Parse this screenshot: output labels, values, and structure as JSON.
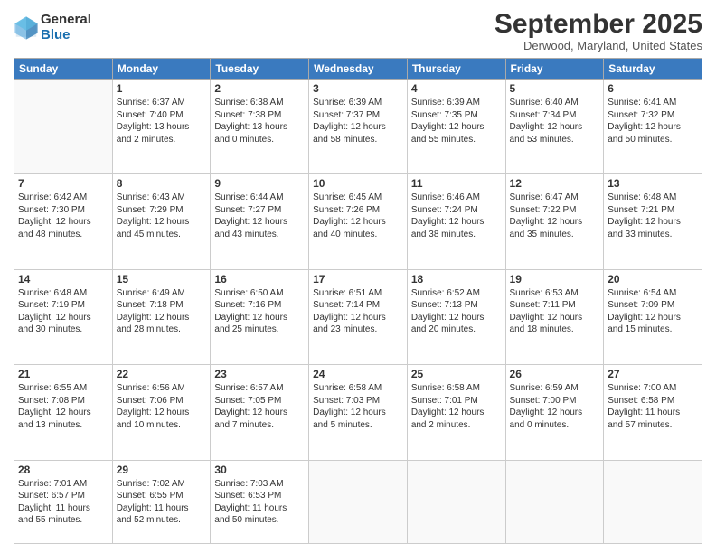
{
  "logo": {
    "general": "General",
    "blue": "Blue"
  },
  "header": {
    "month": "September 2025",
    "location": "Derwood, Maryland, United States"
  },
  "days_of_week": [
    "Sunday",
    "Monday",
    "Tuesday",
    "Wednesday",
    "Thursday",
    "Friday",
    "Saturday"
  ],
  "weeks": [
    [
      {
        "day": "",
        "lines": []
      },
      {
        "day": "1",
        "lines": [
          "Sunrise: 6:37 AM",
          "Sunset: 7:40 PM",
          "Daylight: 13 hours",
          "and 2 minutes."
        ]
      },
      {
        "day": "2",
        "lines": [
          "Sunrise: 6:38 AM",
          "Sunset: 7:38 PM",
          "Daylight: 13 hours",
          "and 0 minutes."
        ]
      },
      {
        "day": "3",
        "lines": [
          "Sunrise: 6:39 AM",
          "Sunset: 7:37 PM",
          "Daylight: 12 hours",
          "and 58 minutes."
        ]
      },
      {
        "day": "4",
        "lines": [
          "Sunrise: 6:39 AM",
          "Sunset: 7:35 PM",
          "Daylight: 12 hours",
          "and 55 minutes."
        ]
      },
      {
        "day": "5",
        "lines": [
          "Sunrise: 6:40 AM",
          "Sunset: 7:34 PM",
          "Daylight: 12 hours",
          "and 53 minutes."
        ]
      },
      {
        "day": "6",
        "lines": [
          "Sunrise: 6:41 AM",
          "Sunset: 7:32 PM",
          "Daylight: 12 hours",
          "and 50 minutes."
        ]
      }
    ],
    [
      {
        "day": "7",
        "lines": [
          "Sunrise: 6:42 AM",
          "Sunset: 7:30 PM",
          "Daylight: 12 hours",
          "and 48 minutes."
        ]
      },
      {
        "day": "8",
        "lines": [
          "Sunrise: 6:43 AM",
          "Sunset: 7:29 PM",
          "Daylight: 12 hours",
          "and 45 minutes."
        ]
      },
      {
        "day": "9",
        "lines": [
          "Sunrise: 6:44 AM",
          "Sunset: 7:27 PM",
          "Daylight: 12 hours",
          "and 43 minutes."
        ]
      },
      {
        "day": "10",
        "lines": [
          "Sunrise: 6:45 AM",
          "Sunset: 7:26 PM",
          "Daylight: 12 hours",
          "and 40 minutes."
        ]
      },
      {
        "day": "11",
        "lines": [
          "Sunrise: 6:46 AM",
          "Sunset: 7:24 PM",
          "Daylight: 12 hours",
          "and 38 minutes."
        ]
      },
      {
        "day": "12",
        "lines": [
          "Sunrise: 6:47 AM",
          "Sunset: 7:22 PM",
          "Daylight: 12 hours",
          "and 35 minutes."
        ]
      },
      {
        "day": "13",
        "lines": [
          "Sunrise: 6:48 AM",
          "Sunset: 7:21 PM",
          "Daylight: 12 hours",
          "and 33 minutes."
        ]
      }
    ],
    [
      {
        "day": "14",
        "lines": [
          "Sunrise: 6:48 AM",
          "Sunset: 7:19 PM",
          "Daylight: 12 hours",
          "and 30 minutes."
        ]
      },
      {
        "day": "15",
        "lines": [
          "Sunrise: 6:49 AM",
          "Sunset: 7:18 PM",
          "Daylight: 12 hours",
          "and 28 minutes."
        ]
      },
      {
        "day": "16",
        "lines": [
          "Sunrise: 6:50 AM",
          "Sunset: 7:16 PM",
          "Daylight: 12 hours",
          "and 25 minutes."
        ]
      },
      {
        "day": "17",
        "lines": [
          "Sunrise: 6:51 AM",
          "Sunset: 7:14 PM",
          "Daylight: 12 hours",
          "and 23 minutes."
        ]
      },
      {
        "day": "18",
        "lines": [
          "Sunrise: 6:52 AM",
          "Sunset: 7:13 PM",
          "Daylight: 12 hours",
          "and 20 minutes."
        ]
      },
      {
        "day": "19",
        "lines": [
          "Sunrise: 6:53 AM",
          "Sunset: 7:11 PM",
          "Daylight: 12 hours",
          "and 18 minutes."
        ]
      },
      {
        "day": "20",
        "lines": [
          "Sunrise: 6:54 AM",
          "Sunset: 7:09 PM",
          "Daylight: 12 hours",
          "and 15 minutes."
        ]
      }
    ],
    [
      {
        "day": "21",
        "lines": [
          "Sunrise: 6:55 AM",
          "Sunset: 7:08 PM",
          "Daylight: 12 hours",
          "and 13 minutes."
        ]
      },
      {
        "day": "22",
        "lines": [
          "Sunrise: 6:56 AM",
          "Sunset: 7:06 PM",
          "Daylight: 12 hours",
          "and 10 minutes."
        ]
      },
      {
        "day": "23",
        "lines": [
          "Sunrise: 6:57 AM",
          "Sunset: 7:05 PM",
          "Daylight: 12 hours",
          "and 7 minutes."
        ]
      },
      {
        "day": "24",
        "lines": [
          "Sunrise: 6:58 AM",
          "Sunset: 7:03 PM",
          "Daylight: 12 hours",
          "and 5 minutes."
        ]
      },
      {
        "day": "25",
        "lines": [
          "Sunrise: 6:58 AM",
          "Sunset: 7:01 PM",
          "Daylight: 12 hours",
          "and 2 minutes."
        ]
      },
      {
        "day": "26",
        "lines": [
          "Sunrise: 6:59 AM",
          "Sunset: 7:00 PM",
          "Daylight: 12 hours",
          "and 0 minutes."
        ]
      },
      {
        "day": "27",
        "lines": [
          "Sunrise: 7:00 AM",
          "Sunset: 6:58 PM",
          "Daylight: 11 hours",
          "and 57 minutes."
        ]
      }
    ],
    [
      {
        "day": "28",
        "lines": [
          "Sunrise: 7:01 AM",
          "Sunset: 6:57 PM",
          "Daylight: 11 hours",
          "and 55 minutes."
        ]
      },
      {
        "day": "29",
        "lines": [
          "Sunrise: 7:02 AM",
          "Sunset: 6:55 PM",
          "Daylight: 11 hours",
          "and 52 minutes."
        ]
      },
      {
        "day": "30",
        "lines": [
          "Sunrise: 7:03 AM",
          "Sunset: 6:53 PM",
          "Daylight: 11 hours",
          "and 50 minutes."
        ]
      },
      {
        "day": "",
        "lines": []
      },
      {
        "day": "",
        "lines": []
      },
      {
        "day": "",
        "lines": []
      },
      {
        "day": "",
        "lines": []
      }
    ]
  ]
}
